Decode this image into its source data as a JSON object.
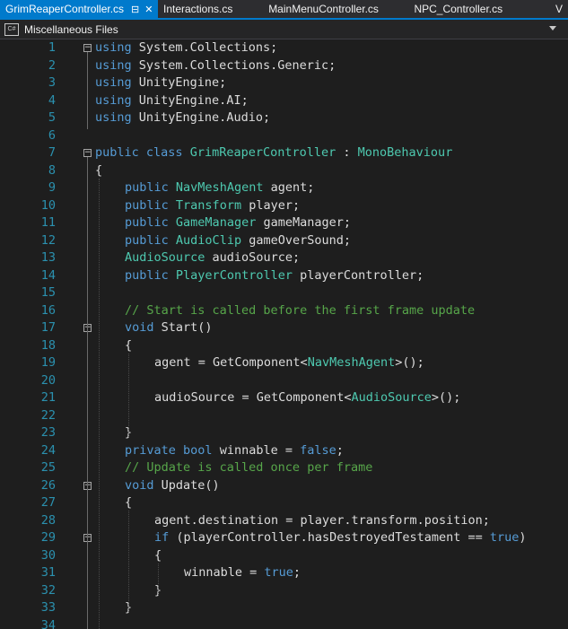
{
  "tabs": [
    {
      "label": "GrimReaperController.cs",
      "active": true
    },
    {
      "label": "Interactions.cs",
      "active": false
    },
    {
      "label": "MainMenuController.cs",
      "active": false
    },
    {
      "label": "NPC_Controller.cs",
      "active": false
    },
    {
      "label": "V",
      "active": false
    }
  ],
  "navbar": {
    "icon_text": "C#",
    "project": "Miscellaneous Files"
  },
  "lines": [
    {
      "n": "1",
      "fold": true,
      "tokens": [
        [
          "kw",
          "using"
        ],
        [
          "",
          "System.Collections;"
        ]
      ]
    },
    {
      "n": "2",
      "tokens": [
        [
          "kw",
          "using"
        ],
        [
          "",
          "System.Collections.Generic;"
        ]
      ]
    },
    {
      "n": "3",
      "tokens": [
        [
          "kw",
          "using"
        ],
        [
          "",
          "UnityEngine;"
        ]
      ]
    },
    {
      "n": "4",
      "tokens": [
        [
          "kw",
          "using"
        ],
        [
          "",
          "UnityEngine.AI;"
        ]
      ]
    },
    {
      "n": "5",
      "tokens": [
        [
          "kw",
          "using"
        ],
        [
          "",
          "UnityEngine.Audio;"
        ]
      ]
    },
    {
      "n": "6",
      "tokens": []
    },
    {
      "n": "7",
      "fold": true,
      "tokens": [
        [
          "kw",
          "public"
        ],
        [
          "kw",
          "class"
        ],
        [
          "ty",
          "GrimReaperController"
        ],
        [
          "",
          " : "
        ],
        [
          "ty",
          "MonoBehaviour"
        ]
      ]
    },
    {
      "n": "8",
      "tokens": [
        [
          "",
          "{"
        ]
      ]
    },
    {
      "n": "9",
      "indent": 1,
      "tokens": [
        [
          "kw",
          "public"
        ],
        [
          "ty",
          "NavMeshAgent"
        ],
        [
          "",
          "agent;"
        ]
      ]
    },
    {
      "n": "10",
      "indent": 1,
      "tokens": [
        [
          "kw",
          "public"
        ],
        [
          "ty",
          "Transform"
        ],
        [
          "",
          "player;"
        ]
      ]
    },
    {
      "n": "11",
      "indent": 1,
      "tokens": [
        [
          "kw",
          "public"
        ],
        [
          "ty",
          "GameManager"
        ],
        [
          "",
          "gameManager;"
        ]
      ]
    },
    {
      "n": "12",
      "indent": 1,
      "tokens": [
        [
          "kw",
          "public"
        ],
        [
          "ty",
          "AudioClip"
        ],
        [
          "",
          "gameOverSound;"
        ]
      ]
    },
    {
      "n": "13",
      "indent": 1,
      "tokens": [
        [
          "ty",
          "AudioSource"
        ],
        [
          "",
          "audioSource;"
        ]
      ]
    },
    {
      "n": "14",
      "indent": 1,
      "tokens": [
        [
          "kw",
          "public"
        ],
        [
          "ty",
          "PlayerController"
        ],
        [
          "",
          "playerController;"
        ]
      ]
    },
    {
      "n": "15",
      "tokens": []
    },
    {
      "n": "16",
      "indent": 1,
      "tokens": [
        [
          "cm",
          "// Start is called before the first frame update"
        ]
      ]
    },
    {
      "n": "17",
      "indent": 1,
      "fold": true,
      "tokens": [
        [
          "kw",
          "void"
        ],
        [
          "",
          "Start()"
        ]
      ]
    },
    {
      "n": "18",
      "indent": 1,
      "tokens": [
        [
          "",
          "{"
        ]
      ]
    },
    {
      "n": "19",
      "indent": 2,
      "tokens": [
        [
          "",
          "agent = GetComponent<"
        ],
        [
          "ty",
          "NavMeshAgent"
        ],
        [
          "",
          ">();"
        ]
      ]
    },
    {
      "n": "20",
      "tokens": []
    },
    {
      "n": "21",
      "indent": 2,
      "tokens": [
        [
          "",
          "audioSource = GetComponent<"
        ],
        [
          "ty",
          "AudioSource"
        ],
        [
          "",
          ">();"
        ]
      ]
    },
    {
      "n": "22",
      "tokens": []
    },
    {
      "n": "23",
      "indent": 1,
      "tokens": [
        [
          "",
          "}"
        ]
      ]
    },
    {
      "n": "24",
      "indent": 1,
      "tokens": [
        [
          "kw",
          "private"
        ],
        [
          "kw",
          "bool"
        ],
        [
          "",
          "winnable = "
        ],
        [
          "kw",
          "false"
        ],
        [
          "",
          ";"
        ]
      ]
    },
    {
      "n": "25",
      "indent": 1,
      "tokens": [
        [
          "cm",
          "// Update is called once per frame"
        ]
      ]
    },
    {
      "n": "26",
      "indent": 1,
      "fold": true,
      "tokens": [
        [
          "kw",
          "void"
        ],
        [
          "",
          "Update()"
        ]
      ]
    },
    {
      "n": "27",
      "indent": 1,
      "tokens": [
        [
          "",
          "{"
        ]
      ]
    },
    {
      "n": "28",
      "indent": 2,
      "tokens": [
        [
          "",
          "agent.destination = player.transform.position;"
        ]
      ]
    },
    {
      "n": "29",
      "indent": 2,
      "fold": true,
      "tokens": [
        [
          "kw",
          "if"
        ],
        [
          "",
          "(playerController.hasDestroyedTestament == "
        ],
        [
          "kw",
          "true"
        ],
        [
          "",
          ")"
        ]
      ]
    },
    {
      "n": "30",
      "indent": 2,
      "tokens": [
        [
          "",
          "{"
        ]
      ]
    },
    {
      "n": "31",
      "indent": 3,
      "tokens": [
        [
          "",
          "winnable = "
        ],
        [
          "kw",
          "true"
        ],
        [
          "",
          ";"
        ]
      ]
    },
    {
      "n": "32",
      "indent": 2,
      "tokens": [
        [
          "",
          "}"
        ]
      ]
    },
    {
      "n": "33",
      "indent": 1,
      "tokens": [
        [
          "",
          "}"
        ]
      ]
    },
    {
      "n": "34",
      "tokens": []
    }
  ]
}
